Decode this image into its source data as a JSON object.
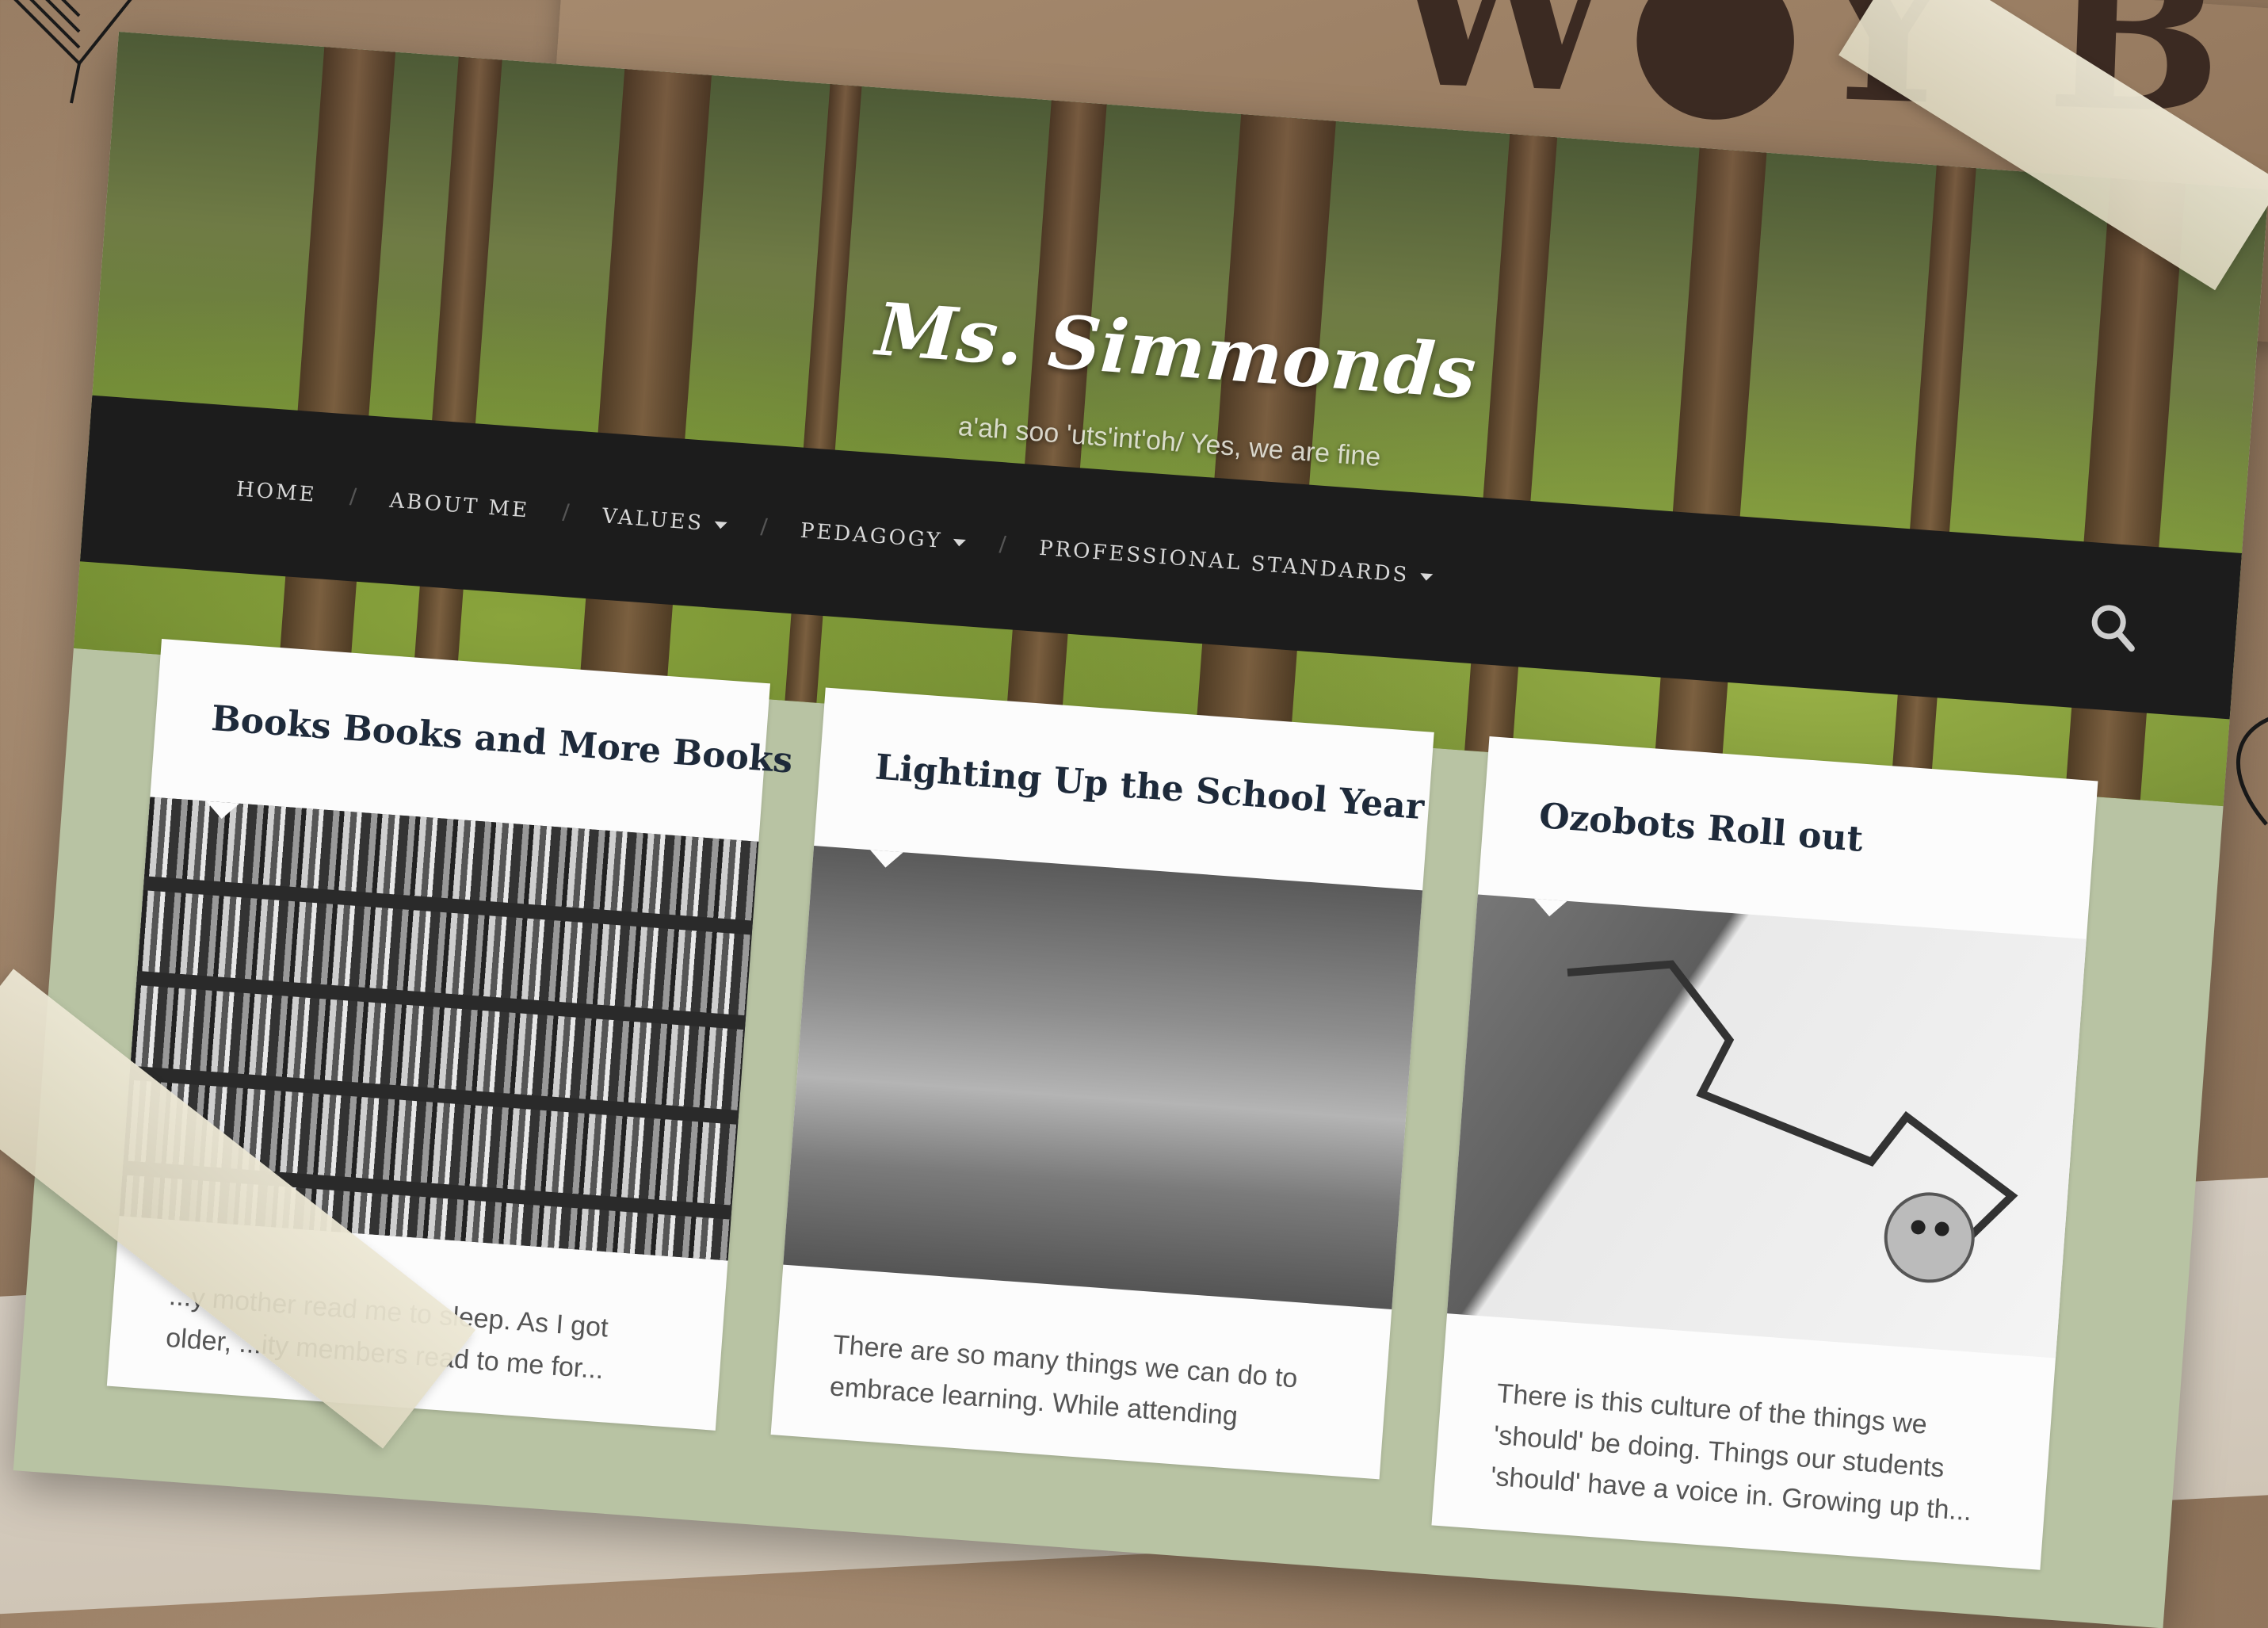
{
  "site": {
    "title": "Ms. Simmonds",
    "tagline": "a'ah soo 'uts'int'oh/ Yes, we are fine"
  },
  "nav": {
    "items": [
      {
        "label": "HOME",
        "has_dropdown": false
      },
      {
        "label": "ABOUT ME",
        "has_dropdown": false
      },
      {
        "label": "VALUES",
        "has_dropdown": true
      },
      {
        "label": "PEDAGOGY",
        "has_dropdown": true
      },
      {
        "label": "PROFESSIONAL STANDARDS",
        "has_dropdown": true
      }
    ],
    "search_icon": "search-icon"
  },
  "posts": [
    {
      "title": "Books Books and More Books",
      "image": "bookshelf photo",
      "excerpt": "...y mother read me to sleep. As I got older, ...ity members read to me for..."
    },
    {
      "title": "Lighting Up the School Year",
      "image": "fire pit photo",
      "excerpt": "There are so many things we can do to embrace learning. While attending"
    },
    {
      "title": "Ozobots Roll out",
      "image": "ozobot photo",
      "excerpt": "There is this culture of the things we 'should' be doing. Things our students 'should' have a voice in. Growing up th..."
    }
  ],
  "colors": {
    "nav_bg": "#1c1c1c",
    "content_bg": "#b8c3a3",
    "title_color": "#1e2a3a"
  }
}
